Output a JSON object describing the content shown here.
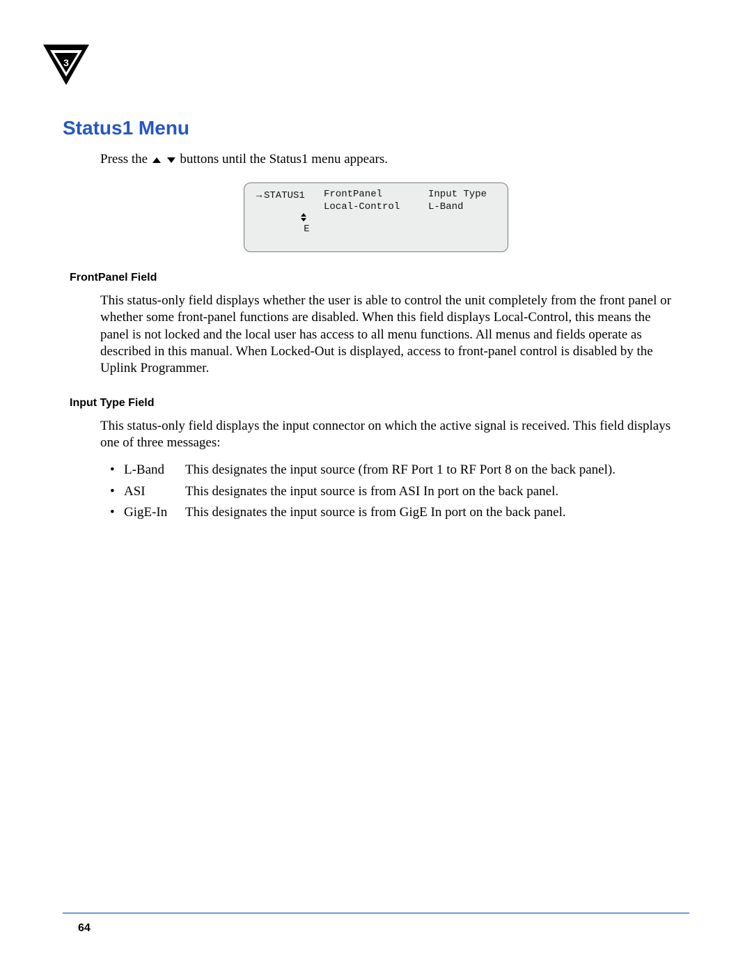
{
  "corner": {
    "number": "3"
  },
  "heading": "Status1 Menu",
  "intro": {
    "pre": "Press the ",
    "post": " buttons until the Status1 menu appears."
  },
  "lcd": {
    "r1c1": "STATUS1",
    "r1c2": "FrontPanel",
    "r1c3": "Input Type",
    "r2c1": "E",
    "r2c2": "Local-Control",
    "r2c3": "L-Band"
  },
  "sub1": "FrontPanel Field",
  "para1": "This status-only field displays whether the user is able to control the unit completely from the front panel or whether some front-panel functions are disabled. When this field displays Local-Control, this means the panel is not locked and the local user has access to all menu functions. All menus and fields operate as described in this manual. When Locked-Out is displayed, access to front-panel control is disabled by the Uplink Programmer.",
  "sub2": "Input Type Field",
  "para2": "This status-only field displays the input connector on which the active signal is received. This field displays one of three messages:",
  "defs": [
    {
      "term": "L-Band",
      "desc": "This designates the input source (from RF Port 1 to RF Port 8 on the back panel)."
    },
    {
      "term": "ASI",
      "desc": "This designates the input source is from ASI In port on the back panel."
    },
    {
      "term": "GigE-In",
      "desc": "This designates the input source is from GigE In port on the back panel."
    }
  ],
  "page_number": "64"
}
